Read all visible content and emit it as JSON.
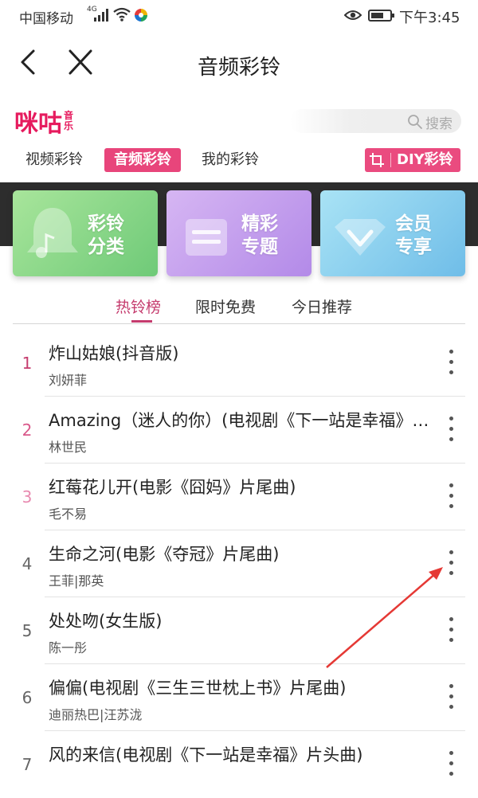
{
  "status_bar": {
    "carrier": "中国移动",
    "network": "4G",
    "time": "下午3:45"
  },
  "header": {
    "title": "音频彩铃"
  },
  "brand": {
    "logo_main": "咪咕",
    "logo_sub_1": "音",
    "logo_sub_2": "乐",
    "search_placeholder": "搜索"
  },
  "tabs": {
    "video": "视频彩铃",
    "audio": "音频彩铃",
    "mine": "我的彩铃",
    "diy": "DIY彩铃"
  },
  "banner": {
    "cards": [
      {
        "line1": "彩铃",
        "line2": "分类"
      },
      {
        "line1": "精彩",
        "line2": "专题"
      },
      {
        "line1": "会员",
        "line2": "专享"
      }
    ]
  },
  "sub_tabs": {
    "hot": "热铃榜",
    "free": "限时免费",
    "today": "今日推荐",
    "active": "hot"
  },
  "songs": [
    {
      "rank": "1",
      "title": "炸山姑娘(抖音版)",
      "artist": "刘妍菲",
      "rank_color": "#c53c6e"
    },
    {
      "rank": "2",
      "title": "Amazing（迷人的你）(电视剧《下一站是幸福》插曲)",
      "artist": "林世民",
      "rank_color": "#d9588a"
    },
    {
      "rank": "3",
      "title": "红莓花儿开(电影《囧妈》片尾曲)",
      "artist": "毛不易",
      "rank_color": "#e88ab0"
    },
    {
      "rank": "4",
      "title": "生命之河(电影《夺冠》片尾曲)",
      "artist": "王菲|那英",
      "rank_color": "#666666"
    },
    {
      "rank": "5",
      "title": "处处吻(女生版)",
      "artist": "陈一彤",
      "rank_color": "#666666"
    },
    {
      "rank": "6",
      "title": "偏偏(电视剧《三生三世枕上书》片尾曲)",
      "artist": "迪丽热巴|汪苏泷",
      "rank_color": "#666666"
    },
    {
      "rank": "7",
      "title": "风的来信(电视剧《下一站是幸福》片头曲)",
      "artist": "",
      "rank_color": "#666666"
    }
  ],
  "colors": {
    "brand_pink": "#e61b5e",
    "tab_active_bg": "#e8457b",
    "annotation_arrow": "#e53935"
  },
  "icons": {
    "back": "chevron-left-icon",
    "close": "close-icon",
    "search": "search-icon",
    "more": "more-vertical-icon",
    "crop": "crop-icon",
    "bell": "bell-icon",
    "topic": "list-card-icon",
    "vip": "chevron-badge-icon"
  }
}
